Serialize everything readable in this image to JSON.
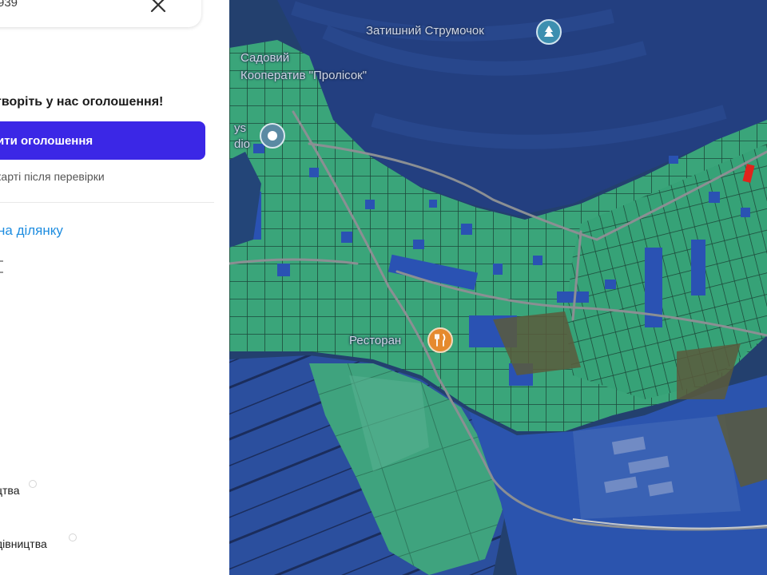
{
  "search": {
    "value": "939"
  },
  "promo": {
    "title": "творіть у нас оголошення!",
    "button_label": "ити оголошення",
    "note": "карті після перевірки"
  },
  "link": {
    "label": "на ділянку"
  },
  "categories": [
    {
      "label": "цтва"
    },
    {
      "label": "дівництва"
    }
  ],
  "map": {
    "labels": {
      "stream": "Затишний Струмочок",
      "coop_line1": "Садовий",
      "coop_line2": "Кооператив \"Пролісок\"",
      "studio_line1": "ys",
      "studio_line2": "dio",
      "restaurant": "Ресторан"
    }
  },
  "colors": {
    "accent": "#3b27e6",
    "link": "#1e8de0",
    "parcel_green": "#3aa57a",
    "parcel_blue": "#2a52b3",
    "parcel_red": "#e0241c"
  }
}
